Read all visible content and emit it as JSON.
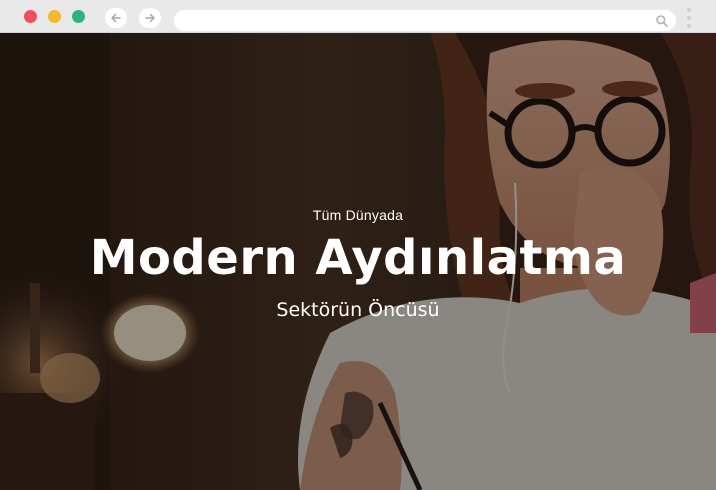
{
  "browser": {
    "controls": {
      "close_color": "#ee4f5a",
      "minimize_color": "#f5b82e",
      "maximize_color": "#2bb57a"
    },
    "nav": {
      "back_icon": "arrow-left-icon",
      "forward_icon": "arrow-right-icon"
    },
    "address_bar": {
      "value": "",
      "search_icon": "search-icon"
    },
    "menu_icon": "kebab-menu-icon"
  },
  "hero": {
    "eyebrow": "Tüm Dünyada",
    "title": "Modern Aydınlatma",
    "subtitle": "Sektörün Öncüsü"
  }
}
